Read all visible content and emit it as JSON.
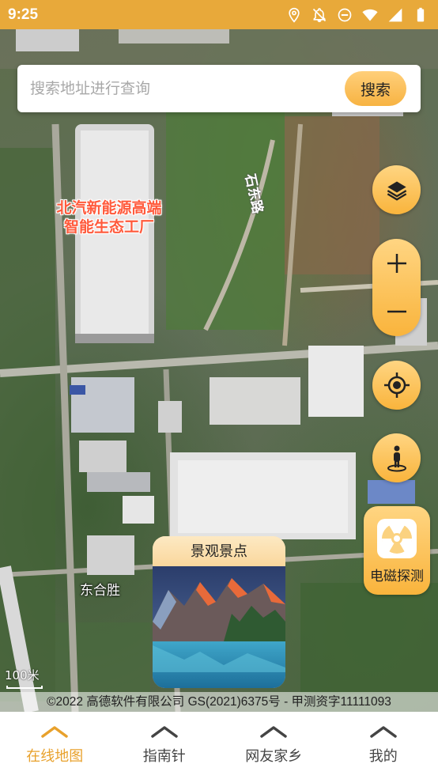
{
  "status_bar": {
    "time": "9:25",
    "icons": [
      "location-icon",
      "notifications-off-icon",
      "do-not-disturb-icon",
      "wifi-icon",
      "signal-icon",
      "battery-icon"
    ]
  },
  "search": {
    "placeholder": "搜索地址进行查询",
    "button_label": "搜索"
  },
  "map": {
    "labels": {
      "factory": "北汽新能源高端智能生态工厂",
      "factory_line1": "北汽新能源高端",
      "factory_line2": "智能生态工厂",
      "road": "石东路",
      "village": "东合胜"
    },
    "scale": "100米",
    "copyright": "©2022 高德软件有限公司 GS(2021)6375号 - 甲测资字11111093"
  },
  "controls": {
    "layers_icon": "layers-icon",
    "zoom_in": "+",
    "zoom_out": "−",
    "locate_icon": "locate-icon",
    "street_view_icon": "person-icon",
    "emf_label": "电磁探测",
    "emf_icon": "radiation-icon"
  },
  "scenic_card": {
    "title": "景观景点"
  },
  "bottom_nav": {
    "items": [
      {
        "label": "在线地图",
        "active": true
      },
      {
        "label": "指南针",
        "active": false
      },
      {
        "label": "网友家乡",
        "active": false
      },
      {
        "label": "我的",
        "active": false
      }
    ]
  },
  "colors": {
    "accent": "#e8a93a",
    "accent_light": "#ffd582",
    "active_nav": "#e8a12c",
    "inactive_nav": "#444444",
    "factory_label": "#ff5a3c"
  }
}
